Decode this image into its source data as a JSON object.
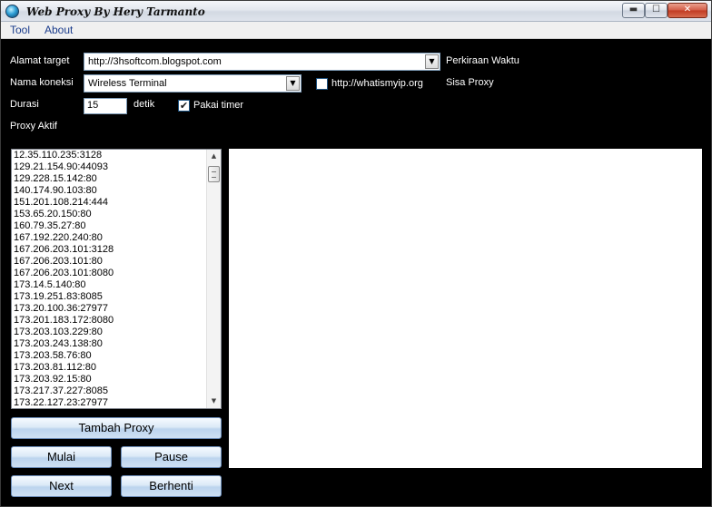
{
  "window": {
    "title": "Web Proxy By Hery Tarmanto",
    "min_glyph": "▬",
    "max_glyph": "☐",
    "close_glyph": "✕"
  },
  "menu": {
    "tool": "Tool",
    "about": "About"
  },
  "form": {
    "target_label": "Alamat target",
    "target_value": "http://3hsoftcom.blogspot.com",
    "connection_label": "Nama koneksi",
    "connection_value": "Wireless Terminal",
    "duration_label": "Durasi",
    "duration_value": "15",
    "duration_unit": "detik",
    "timer_label": "Pakai timer",
    "timer_checked": true,
    "whatismyip_label": "http://whatismyip.org",
    "whatismyip_checked": false,
    "estimate_label": "Perkiraan Waktu",
    "remaining_label": "Sisa Proxy",
    "active_proxy_label": "Proxy Aktif",
    "dropdown_icon": "chevron-down-icon"
  },
  "proxies": [
    "12.35.110.235:3128",
    "129.21.154.90:44093",
    "129.228.15.142:80",
    "140.174.90.103:80",
    "151.201.108.214:444",
    "153.65.20.150:80",
    "160.79.35.27:80",
    "167.192.220.240:80",
    "167.206.203.101:3128",
    "167.206.203.101:80",
    "167.206.203.101:8080",
    "173.14.5.140:80",
    "173.19.251.83:8085",
    "173.20.100.36:27977",
    "173.201.183.172:8080",
    "173.203.103.229:80",
    "173.203.243.138:80",
    "173.203.58.76:80",
    "173.203.81.112:80",
    "173.203.92.15:80",
    "173.217.37.227:8085",
    "173.22.127.23:27977"
  ],
  "buttons": {
    "add_proxy": "Tambah Proxy",
    "start": "Mulai",
    "pause": "Pause",
    "next": "Next",
    "stop": "Berhenti"
  }
}
